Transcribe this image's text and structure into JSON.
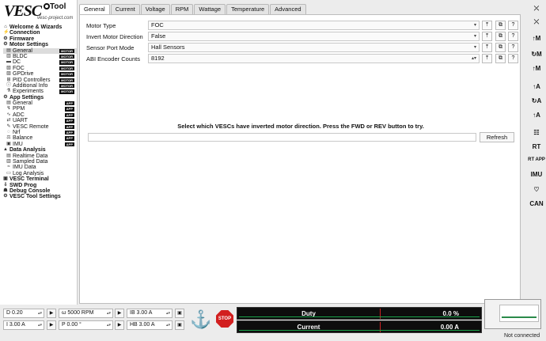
{
  "logo": {
    "brand": "VESC",
    "tool": "Tool",
    "url": "vesc-project.com"
  },
  "sidebar": {
    "items": [
      {
        "label": "Welcome & Wizards",
        "level": 0,
        "icon": "⌂"
      },
      {
        "label": "Connection",
        "level": 0,
        "icon": "⚡"
      },
      {
        "label": "Firmware",
        "level": 0,
        "icon": "⚙"
      },
      {
        "label": "Motor Settings",
        "level": 0,
        "icon": "⚙"
      },
      {
        "label": "General",
        "level": 1,
        "icon": "▤",
        "badge": "MOTOR",
        "selected": true
      },
      {
        "label": "BLDC",
        "level": 1,
        "icon": "▥",
        "badge": "MOTOR"
      },
      {
        "label": "DC",
        "level": 1,
        "icon": "▬",
        "badge": "MOTOR"
      },
      {
        "label": "FOC",
        "level": 1,
        "icon": "▧",
        "badge": "MOTOR"
      },
      {
        "label": "GPDrive",
        "level": 1,
        "icon": "▨",
        "badge": "MOTOR"
      },
      {
        "label": "PID Controllers",
        "level": 1,
        "icon": "⊞",
        "badge": "MOTOR"
      },
      {
        "label": "Additional Info",
        "level": 1,
        "icon": "ⓘ",
        "badge": "MOTOR"
      },
      {
        "label": "Experiments",
        "level": 1,
        "icon": "⚗",
        "badge": "MOTOR"
      },
      {
        "label": "App Settings",
        "level": 0,
        "icon": "⚙"
      },
      {
        "label": "General",
        "level": 1,
        "icon": "▤",
        "badge": "APP"
      },
      {
        "label": "PPM",
        "level": 1,
        "icon": "↯",
        "badge": "APP"
      },
      {
        "label": "ADC",
        "level": 1,
        "icon": "∿",
        "badge": "APP"
      },
      {
        "label": "UART",
        "level": 1,
        "icon": "⇄",
        "badge": "APP"
      },
      {
        "label": "VESC Remote",
        "level": 1,
        "icon": "✎",
        "badge": "APP"
      },
      {
        "label": "Nrf",
        "level": 1,
        "icon": "◌",
        "badge": "APP"
      },
      {
        "label": "Balance",
        "level": 1,
        "icon": "⚖",
        "badge": "APP"
      },
      {
        "label": "IMU",
        "level": 1,
        "icon": "▣",
        "badge": "APP"
      },
      {
        "label": "Data Analysis",
        "level": 0,
        "icon": "▲"
      },
      {
        "label": "Realtime Data",
        "level": 1,
        "icon": "▤"
      },
      {
        "label": "Sampled Data",
        "level": 1,
        "icon": "▥"
      },
      {
        "label": "IMU Data",
        "level": 1,
        "icon": "≈"
      },
      {
        "label": "Log Analysis",
        "level": 1,
        "icon": "▭"
      },
      {
        "label": "VESC Terminal",
        "level": 0,
        "icon": "▣"
      },
      {
        "label": "SWD Prog",
        "level": 0,
        "icon": "⇩"
      },
      {
        "label": "Debug Console",
        "level": 0,
        "icon": "☗"
      },
      {
        "label": "VESC Tool Settings",
        "level": 0,
        "icon": "⚙"
      }
    ]
  },
  "tabs": [
    "General",
    "Current",
    "Voltage",
    "RPM",
    "Wattage",
    "Temperature",
    "Advanced"
  ],
  "params": [
    {
      "label": "Motor Type",
      "value": "FOC",
      "control": "dropdown"
    },
    {
      "label": "Invert Motor Direction",
      "value": "False",
      "control": "dropdown"
    },
    {
      "label": "Sensor Port Mode",
      "value": "Hall Sensors",
      "control": "dropdown"
    },
    {
      "label": "ABI Encoder Counts",
      "value": "8192",
      "control": "spinbox"
    }
  ],
  "param_buttons": {
    "upload": "⤒",
    "copy": "⧉",
    "help": "?"
  },
  "inverted": {
    "message": "Select which VESCs have inverted motor direction. Press the FWD or REV button to try.",
    "refresh_label": "Refresh"
  },
  "right_toolbar": [
    "⤫",
    "⤫",
    "↑M",
    "↻M",
    "↑M",
    "↑A",
    "↻A",
    "↑A",
    "☷",
    "RT",
    "RT APP",
    "IMU",
    "♡",
    "CAN"
  ],
  "controls": {
    "duty": "D 0.20",
    "rpm": "ω 5000 RPM",
    "ib": "IB 3.00 A",
    "current": "I 3.00 A",
    "position": "P 0.00 °",
    "hb": "HB 3.00 A",
    "stop_label": "STOP"
  },
  "bars": {
    "duty": {
      "label": "Duty",
      "value": "0.0 %"
    },
    "current": {
      "label": "Current",
      "value": "0.00 A"
    }
  },
  "status": "Not connected",
  "colors": {
    "accent": "#1aa24a",
    "stop": "#d21f1f",
    "bar_bg": "#0d0d0d"
  }
}
